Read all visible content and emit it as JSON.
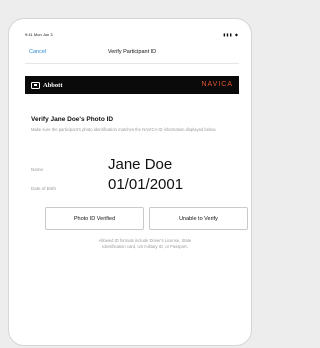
{
  "status_bar": {
    "time": "9:41 Mon Jun 3",
    "icons": "▮▮▮ ◆"
  },
  "nav": {
    "cancel_label": "Cancel",
    "title": "Verify Participant ID"
  },
  "brand": {
    "abbott": "Abbott",
    "navica": "NAVICA"
  },
  "verify": {
    "heading": "Verify Jane Doe's Photo ID",
    "instructions": "Make sure the participant's photo identification matches the NAVICA ID information displayed below.",
    "fields": [
      {
        "label": "Name",
        "value": "Jane Doe"
      },
      {
        "label": "Date of Birth",
        "value": "01/01/2001"
      }
    ],
    "buttons": {
      "verified": "Photo ID Verified",
      "unable": "Unable to Verify"
    },
    "footnote": "Allowed ID formats include Driver's License, State Identification card, US military ID, or Passport."
  },
  "colors": {
    "accent_blue": "#2e8bd8",
    "navica_orange": "#e4572e",
    "brand_bar": "#0a0a0a"
  }
}
